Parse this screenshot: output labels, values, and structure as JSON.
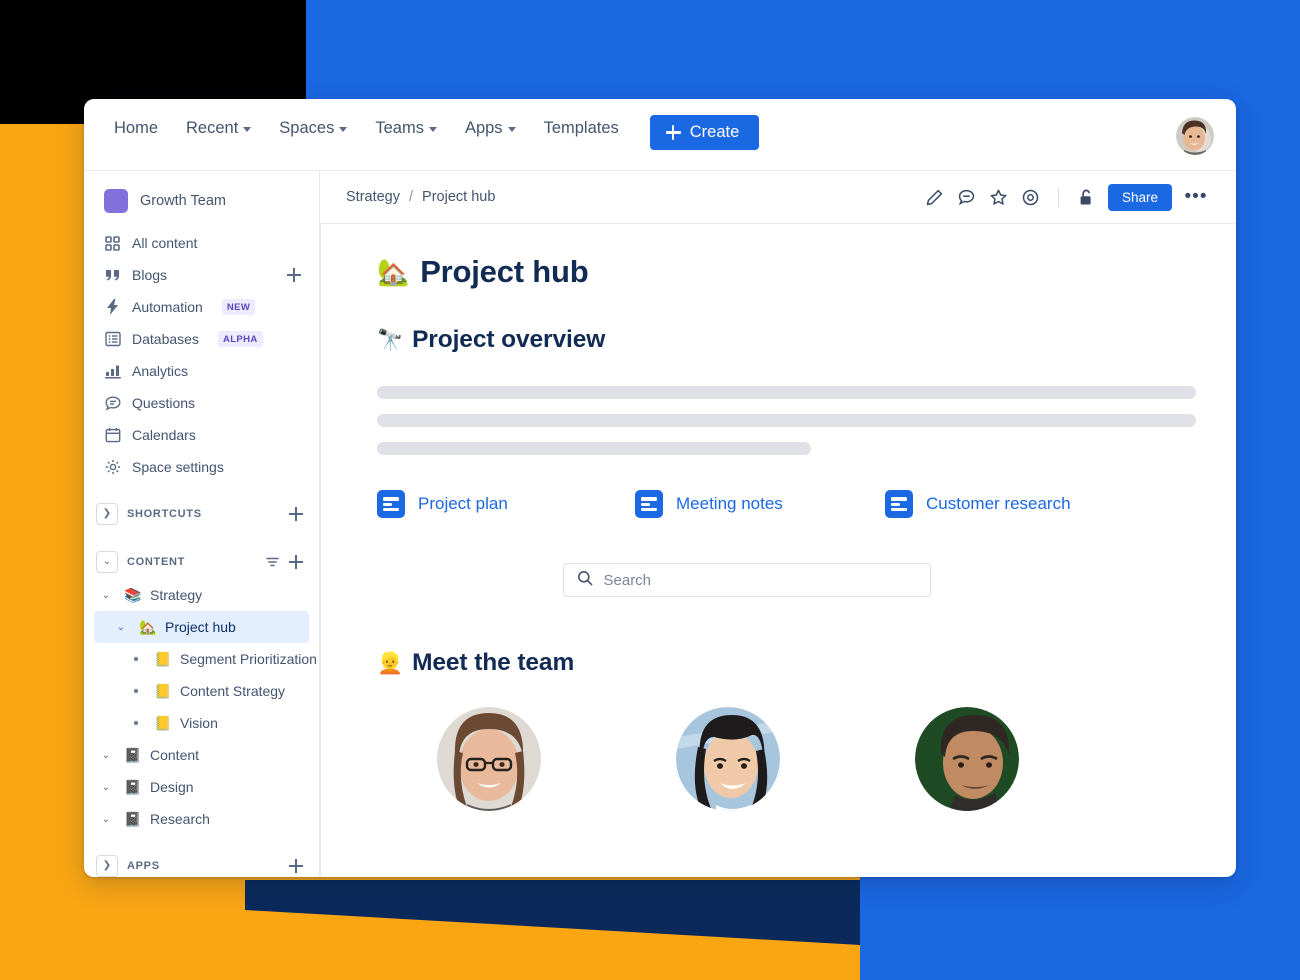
{
  "background": {
    "colors": {
      "blue": "#1b68e3",
      "orange": "#faa613",
      "navy": "#0b2a5b",
      "black": "#000000"
    }
  },
  "topnav": {
    "items": [
      {
        "label": "Home",
        "has_caret": false,
        "icon": ""
      },
      {
        "label": "Recent",
        "has_caret": true,
        "icon": "chevron-down-icon"
      },
      {
        "label": "Spaces",
        "has_caret": true,
        "icon": "chevron-down-icon"
      },
      {
        "label": "Teams",
        "has_caret": true,
        "icon": "chevron-down-icon"
      },
      {
        "label": "Apps",
        "has_caret": true,
        "icon": "chevron-down-icon"
      },
      {
        "label": "Templates",
        "has_caret": false,
        "icon": ""
      }
    ],
    "create_label": "Create",
    "create_icon": "plus-icon",
    "avatar_icon": "user-avatar"
  },
  "sidebar": {
    "space_name": "Growth Team",
    "space_color": "#8270db",
    "nav": [
      {
        "label": "All content",
        "icon": "grid-icon",
        "badge": null,
        "add": false
      },
      {
        "label": "Blogs",
        "icon": "quote-icon",
        "badge": null,
        "add": true
      },
      {
        "label": "Automation",
        "icon": "bolt-icon",
        "badge": "NEW",
        "add": false
      },
      {
        "label": "Databases",
        "icon": "table-icon",
        "badge": "ALPHA",
        "add": false
      },
      {
        "label": "Analytics",
        "icon": "bar-chart-icon",
        "badge": null,
        "add": false
      },
      {
        "label": "Questions",
        "icon": "chat-icon",
        "badge": null,
        "add": false
      },
      {
        "label": "Calendars",
        "icon": "calendar-icon",
        "badge": null,
        "add": false
      },
      {
        "label": "Space settings",
        "icon": "gear-icon",
        "badge": null,
        "add": false
      }
    ],
    "sections": {
      "shortcuts": {
        "title": "SHORTCUTS",
        "expanded": false,
        "add_icon": "plus-icon"
      },
      "content": {
        "title": "CONTENT",
        "expanded": true,
        "filter_icon": "filter-icon",
        "add_icon": "plus-icon"
      },
      "apps": {
        "title": "APPS",
        "expanded": false,
        "add_icon": "plus-icon"
      }
    },
    "tree": [
      {
        "label": "Strategy",
        "emoji": "📚",
        "indent": 0,
        "chevron": "expanded",
        "active": false,
        "bullet": false
      },
      {
        "label": "Project hub",
        "emoji": "🏡",
        "indent": 1,
        "chevron": "expanded",
        "active": true,
        "bullet": false
      },
      {
        "label": "Segment Prioritization",
        "emoji": "📒",
        "indent": 2,
        "chevron": "none",
        "active": false,
        "bullet": true
      },
      {
        "label": "Content Strategy",
        "emoji": "📒",
        "indent": 2,
        "chevron": "none",
        "active": false,
        "bullet": true
      },
      {
        "label": "Vision",
        "emoji": "📒",
        "indent": 2,
        "chevron": "none",
        "active": false,
        "bullet": true
      },
      {
        "label": "Content",
        "emoji": "📓",
        "indent": 0,
        "chevron": "expanded",
        "active": false,
        "bullet": false
      },
      {
        "label": "Design",
        "emoji": "📓",
        "indent": 0,
        "chevron": "expanded",
        "active": false,
        "bullet": false
      },
      {
        "label": "Research",
        "emoji": "📓",
        "indent": 0,
        "chevron": "expanded",
        "active": false,
        "bullet": false
      }
    ]
  },
  "pagebar": {
    "breadcrumb": {
      "parent": "Strategy",
      "separator": "/",
      "current": "Project hub"
    },
    "actions": [
      {
        "name": "edit-icon",
        "title": "Edit"
      },
      {
        "name": "comment-icon",
        "title": "Comment"
      },
      {
        "name": "star-icon",
        "title": "Star"
      },
      {
        "name": "watch-icon",
        "title": "Watch"
      }
    ],
    "lock_icon": "unlock-icon",
    "share_label": "Share",
    "more_label": "•••"
  },
  "page": {
    "title": "Project hub",
    "title_emoji": "🏡",
    "section_overview": "Project overview",
    "section_overview_emoji": "🔭",
    "placeholder_widths": [
      "100%",
      "100%",
      "53%"
    ],
    "links": [
      {
        "label": "Project plan",
        "icon": "document-icon",
        "color": "#1b68e3"
      },
      {
        "label": "Meeting notes",
        "icon": "document-icon",
        "color": "#1b68e3"
      },
      {
        "label": "Customer research",
        "icon": "document-icon",
        "color": "#1b68e3"
      }
    ],
    "search": {
      "placeholder": "Search",
      "value": "",
      "icon": "search-icon"
    },
    "section_team": "Meet the team",
    "section_team_emoji": "👱",
    "team": [
      {
        "name": "team-member-1",
        "hair": "#6b4a33",
        "skin": "#e8b99a",
        "bg": "#ded9d2"
      },
      {
        "name": "team-member-2",
        "hair": "#1d1b1c",
        "skin": "#f0c9a8",
        "bg": "#a7c5dd"
      },
      {
        "name": "team-member-3",
        "hair": "#2e2722",
        "skin": "#c08b63",
        "bg": "#1e4b23"
      }
    ]
  }
}
